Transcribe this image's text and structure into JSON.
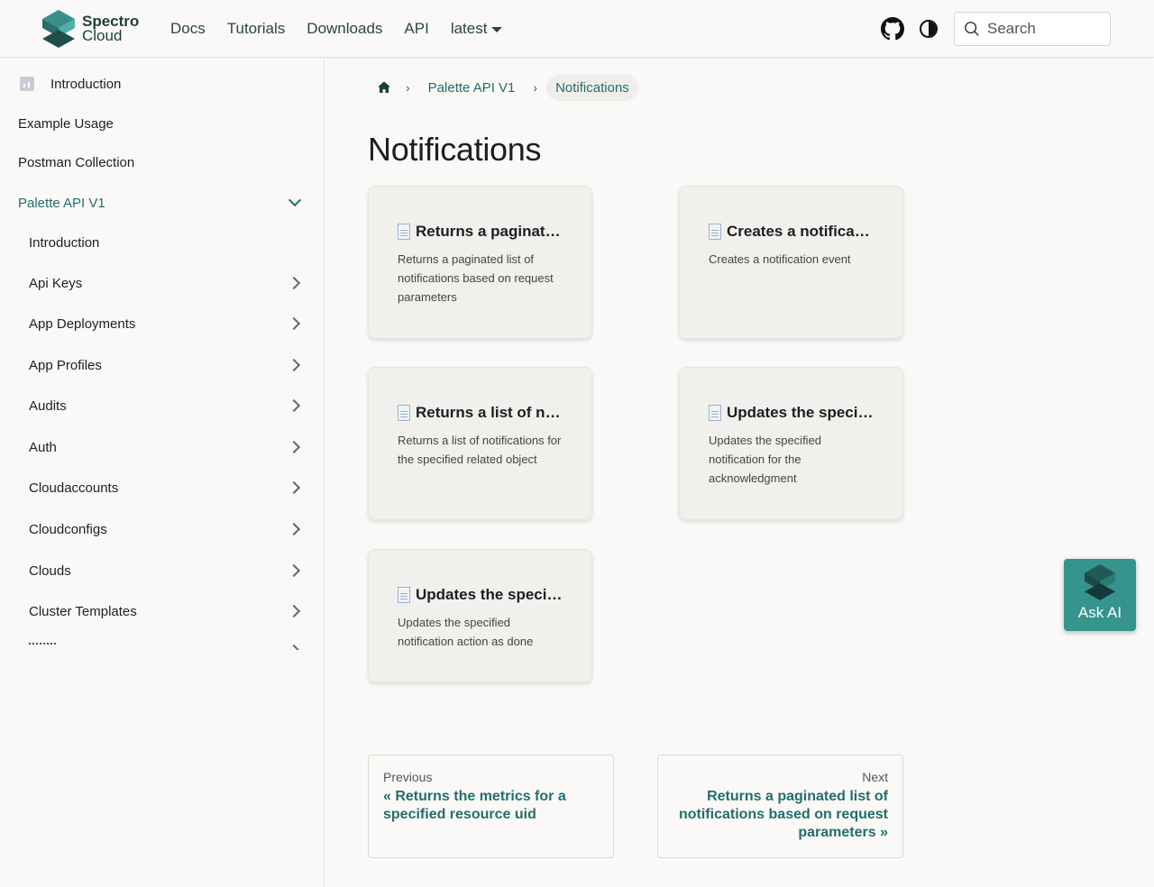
{
  "navbar": {
    "logo_line1": "Spectro",
    "logo_line2": "Cloud",
    "links": [
      "Docs",
      "Tutorials",
      "Downloads",
      "API"
    ],
    "version": "latest",
    "search_placeholder": "Search",
    "icons": [
      "github-icon",
      "theme-toggle-icon",
      "search-icon"
    ]
  },
  "sidebar": {
    "items": [
      {
        "label": "Introduction"
      },
      {
        "label": "Example Usage"
      },
      {
        "label": "Postman Collection"
      },
      {
        "label": "Palette API V1"
      },
      {
        "label": "Introduction"
      },
      {
        "label": "Api Keys"
      },
      {
        "label": "App Deployments"
      },
      {
        "label": "App Profiles"
      },
      {
        "label": "Audits"
      },
      {
        "label": "Auth"
      },
      {
        "label": "Cloudaccounts"
      },
      {
        "label": "Cloudconfigs"
      },
      {
        "label": "Clouds"
      },
      {
        "label": "Cluster Templates"
      }
    ]
  },
  "breadcrumbs": {
    "items": [
      "Palette API V1",
      "Notifications"
    ]
  },
  "main": {
    "title": "Notifications",
    "cards": [
      {
        "title": "Returns a paginated list of notifications based on request parameters",
        "desc": "Returns a paginated list of notifications based on request parameters"
      },
      {
        "title": "Creates a notification event",
        "desc": "Creates a notification event"
      },
      {
        "title": "Returns a list of notifications for the specified related object",
        "desc": "Returns a list of notifications for the specified related object"
      },
      {
        "title": "Updates the specified notification for the acknowledgment",
        "desc": "Updates the specified notification for the acknowledgment"
      },
      {
        "title": "Updates the specified notification action as done",
        "desc": "Updates the specified notification action as done"
      }
    ]
  },
  "pager": {
    "prev_sub": "Previous",
    "prev_label": "« Returns the metrics for a specified resource uid",
    "next_sub": "Next",
    "next_label": "Returns a paginated list of notifications based on request parameters »"
  },
  "ask_ai": {
    "label": "Ask AI"
  },
  "colors": {
    "accent": "#226e6b",
    "ask_ai_bg": "#35948d"
  }
}
